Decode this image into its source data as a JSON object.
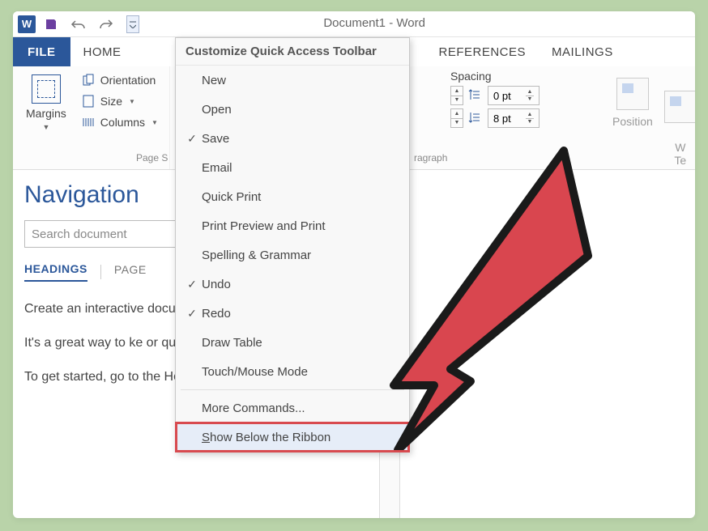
{
  "title": "Document1 - Word",
  "tabs": {
    "file": "FILE",
    "home": "HOME",
    "references": "REFERENCES",
    "mailings": "MAILINGS"
  },
  "ribbon": {
    "margins": "Margins",
    "orientation": "Orientation",
    "size": "Size",
    "columns": "Columns",
    "page_group": "Page S",
    "spacing": "Spacing",
    "before_val": "0 pt",
    "after_val": "8 pt",
    "para_group": "ragraph",
    "position": "Position",
    "wrap": "W\nTe"
  },
  "nav": {
    "title": "Navigation",
    "search_placeholder": "Search document",
    "tab_headings": "HEADINGS",
    "tab_pages": "PAGE",
    "p1": "Create an interactive document.",
    "p2": "It's a great way to ke or quickly move your",
    "p3": "To get started, go to the Home tab and apply"
  },
  "menu": {
    "title": "Customize Quick Access Toolbar",
    "items": [
      {
        "label": "New",
        "checked": false
      },
      {
        "label": "Open",
        "checked": false
      },
      {
        "label": "Save",
        "checked": true
      },
      {
        "label": "Email",
        "checked": false
      },
      {
        "label": "Quick Print",
        "checked": false
      },
      {
        "label": "Print Preview and Print",
        "checked": false
      },
      {
        "label": "Spelling & Grammar",
        "checked": false
      },
      {
        "label": "Undo",
        "checked": true
      },
      {
        "label": "Redo",
        "checked": true
      },
      {
        "label": "Draw Table",
        "checked": false
      },
      {
        "label": "Touch/Mouse Mode",
        "checked": false
      }
    ],
    "more": "More Commands...",
    "show_below": "Show Below the Ribbon"
  }
}
